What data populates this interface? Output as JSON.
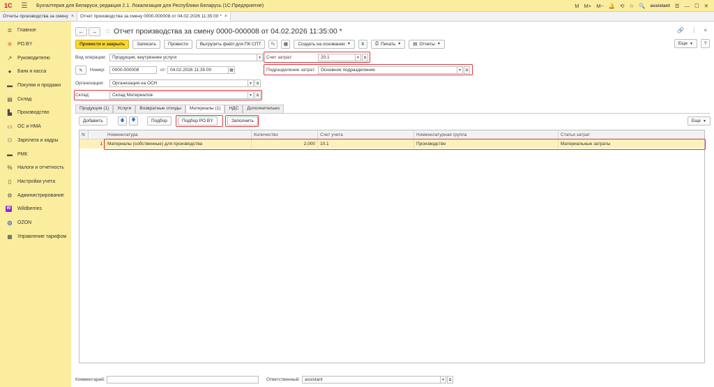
{
  "app": {
    "title": "Бухгалтерия для Беларуси, редакция 2.1. Локализация для Республики Беларусь  (1С:Предприятие)",
    "logo": "1С",
    "user": "assistant",
    "right_icons": [
      "M",
      "M+",
      "M−",
      "🔔",
      "⟲",
      "☆",
      "🔍"
    ]
  },
  "window_tabs": [
    {
      "label": "Отчеты производства за смену",
      "close": "×"
    },
    {
      "label": "Отчет производства за смену 0000-000008 от 04.02.2026 11:35:00 *",
      "close": "×"
    }
  ],
  "sidebar": {
    "items": [
      {
        "label": "Главное",
        "icon": "≣"
      },
      {
        "label": "PO.BY",
        "icon": "✲"
      },
      {
        "label": "Руководителю",
        "icon": "↗"
      },
      {
        "label": "Банк и касса",
        "icon": "●"
      },
      {
        "label": "Покупки и продажи",
        "icon": "▬"
      },
      {
        "label": "Склад",
        "icon": "▤"
      },
      {
        "label": "Производство",
        "icon": "▙"
      },
      {
        "label": "ОС и НМА",
        "icon": "▭"
      },
      {
        "label": "Зарплата и кадры",
        "icon": "⚇"
      },
      {
        "label": "РМК",
        "icon": "▬"
      },
      {
        "label": "Налоги и отчетность",
        "icon": "%"
      },
      {
        "label": "Настройки учета",
        "icon": "▯"
      },
      {
        "label": "Администрирование",
        "icon": "⚙"
      },
      {
        "label": "Wildberries",
        "icon": "W"
      },
      {
        "label": "OZON",
        "icon": "◎"
      },
      {
        "label": "Управление тарифом",
        "icon": "▦"
      }
    ]
  },
  "document": {
    "title": "Отчет производства за смену 0000-000008 от 04.02.2026 11:35:00 *",
    "back": "←",
    "forward": "→",
    "star": "☆",
    "link_icon": "🔗",
    "more_icon": "⋮",
    "close_icon": "×"
  },
  "toolbar": {
    "post_and_close": "Провести и закрыть",
    "save": "Записать",
    "post": "Провести",
    "export": "Выгрузить файл для ПК СПТ",
    "create_based": "Создать на основании",
    "print": "Печать",
    "reports": "Отчеты",
    "more": "Еще",
    "help": "?"
  },
  "form": {
    "operation_label": "Вид операции:",
    "operation_value": "Продукция, внутренние услуги",
    "number_label": "Номер:",
    "number_value": "0000-000008",
    "date_label": "от:",
    "date_value": "04.02.2026 11:35:00",
    "org_label": "Организация:",
    "org_value": "Организация на ОСН",
    "warehouse_label": "Склад:",
    "warehouse_value": "Склад Материалов",
    "account_label": "Счет затрат:",
    "account_value": "20.1",
    "division_label": "Подразделение затрат:",
    "division_value": "Основное подразделение"
  },
  "form_tabs": [
    "Продукция (1)",
    "Услуги",
    "Возвратные отходы",
    "Материалы (1)",
    "НДС",
    "Дополнительно"
  ],
  "table_toolbar": {
    "add": "Добавить",
    "up": "🡅",
    "down": "🡇",
    "select": "Подбор",
    "select_po": "Подбор PO.BY",
    "fill": "Заполнить",
    "more": "Еще"
  },
  "table": {
    "columns": [
      "N",
      "Номенклатура",
      "Количество",
      "Счет учета",
      "Номенклатурная группа",
      "Статья затрат"
    ],
    "rows": [
      {
        "n": "1",
        "item": "Материалы (собственные) для производства",
        "qty": "2,000",
        "account": "10.1",
        "group": "Производство",
        "cost_item": "Материальные затраты"
      }
    ]
  },
  "footer": {
    "comment_label": "Комментарий:",
    "comment_value": "",
    "responsible_label": "Ответственный:",
    "responsible_value": "assistant"
  },
  "colors": {
    "accent_yellow": "#fbed9e",
    "primary_button": "#fbd72c",
    "highlight_red": "#d9383e",
    "row_selected": "#fdf1bb"
  }
}
